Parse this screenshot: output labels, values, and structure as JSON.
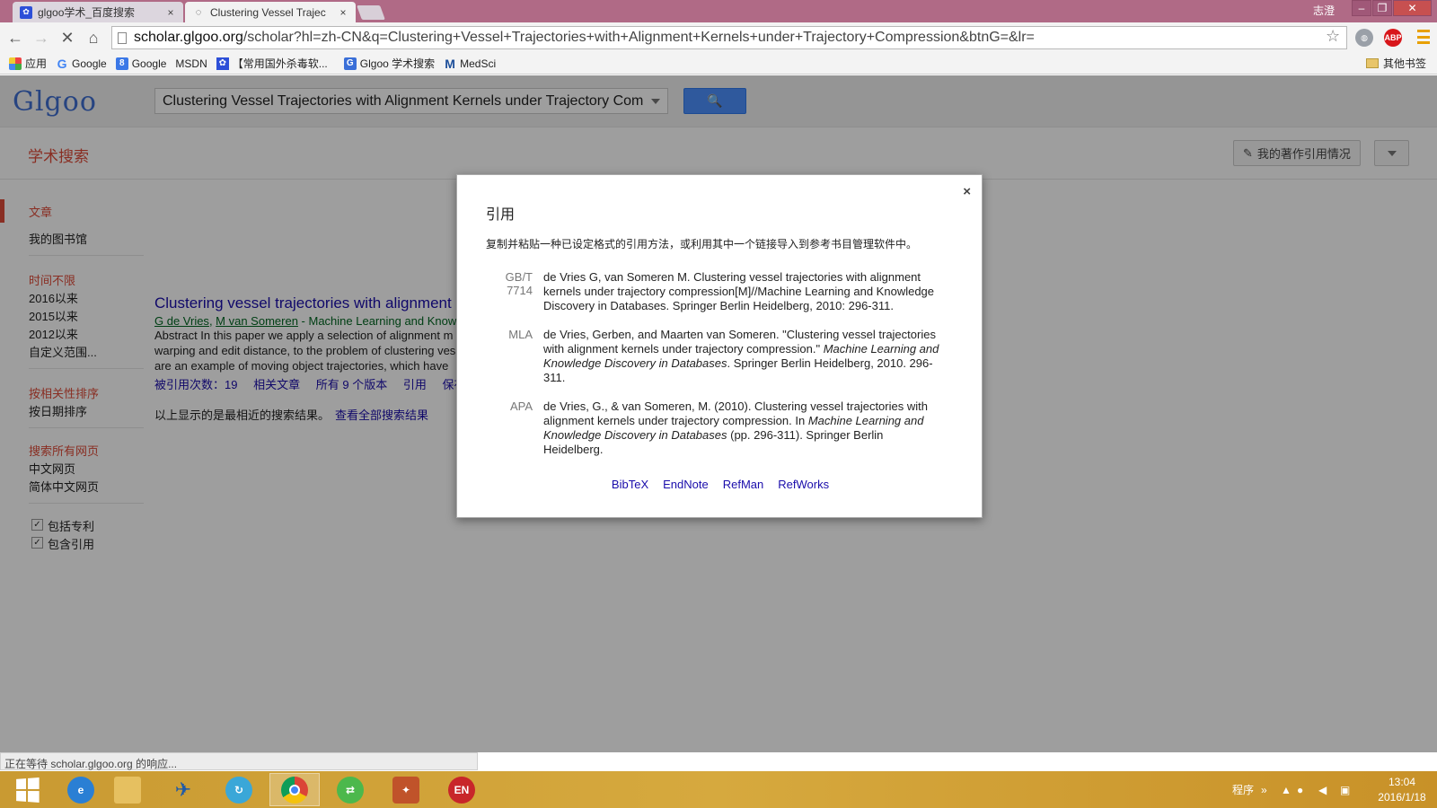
{
  "browser": {
    "tabs": [
      {
        "label": "glgoo学术_百度搜索",
        "close": "×"
      },
      {
        "label": "Clustering Vessel Trajec",
        "close": "×"
      }
    ],
    "user_label": "志澄",
    "url_host": "scholar.glgoo.org",
    "url_rest": "/scholar?hl=zh-CN&q=Clustering+Vessel+Trajectories+with+Alignment+Kernels+under+Trajectory+Compression&btnG=&lr=",
    "ext_abp": "ABP",
    "bookmarks": [
      "应用",
      "Google",
      "Google",
      "MSDN",
      "【常用国外杀毒软...",
      "Glgoo 学术搜索",
      "MedSci"
    ],
    "other_bookmarks": "其他书签"
  },
  "page": {
    "logo": "Glgoo",
    "search_value": "Clustering Vessel Trajectories with Alignment Kernels under Trajectory Com",
    "scholar_label": "学术搜索",
    "my_citations": "我的著作引用情况",
    "sidebar": {
      "articles": "文章",
      "my_library": "我的图书馆",
      "any_time": "时间不限",
      "since_2016": "2016以来",
      "since_2015": "2015以来",
      "since_2012": "2012以来",
      "custom_range": "自定义范围...",
      "sort_relevance": "按相关性排序",
      "sort_date": "按日期排序",
      "all_web": "搜索所有网页",
      "chinese_web": "中文网页",
      "simplified_web": "简体中文网页",
      "include_patents": "包括专利",
      "include_citations": "包含引用"
    },
    "result": {
      "title": "Clustering vessel trajectories with alignment",
      "author1": "G de Vries",
      "author2": "M van Someren",
      "venue": " - Machine Learning and Know",
      "snippet1": "Abstract In this paper we apply a selection of alignment m",
      "snippet2": "warping and edit distance, to the problem of clustering ves",
      "snippet3": "are an example of moving object trajectories, which have",
      "cited_by": "被引用次数：19",
      "related": "相关文章",
      "versions": "所有 9 个版本",
      "cite": "引用",
      "save": "保存"
    },
    "recent_note": "以上显示的是最相近的搜索结果。",
    "see_all": "查看全部搜索结果"
  },
  "modal": {
    "title": "引用",
    "instruction": "复制并粘贴一种已设定格式的引用方法，或利用其中一个链接导入到参考书目管理软件中。",
    "close": "×",
    "citations": [
      {
        "format": "GB/T 7714",
        "text": "de Vries G, van Someren M. Clustering vessel trajectories with alignment kernels under trajectory compression[M]//Machine Learning and Knowledge Discovery in Databases. Springer Berlin Heidelberg, 2010: 296-311."
      },
      {
        "format": "MLA",
        "text_pre": "de Vries, Gerben, and Maarten van Someren. \"Clustering vessel trajectories with alignment kernels under trajectory compression.\" ",
        "text_italic": "Machine Learning and Knowledge Discovery in Databases",
        "text_post": ". Springer Berlin Heidelberg, 2010. 296-311."
      },
      {
        "format": "APA",
        "text_pre": "de Vries, G., & van Someren, M. (2010). Clustering vessel trajectories with alignment kernels under trajectory compression. In ",
        "text_italic": "Machine Learning and Knowledge Discovery in Databases",
        "text_post": " (pp. 296-311). Springer Berlin Heidelberg."
      }
    ],
    "links": [
      "BibTeX",
      "EndNote",
      "RefMan",
      "RefWorks"
    ]
  },
  "status_text": "正在等待 scholar.glgoo.org 的响应...",
  "taskbar": {
    "tray_label": "程序",
    "time": "13:04",
    "date": "2016/1/18"
  }
}
